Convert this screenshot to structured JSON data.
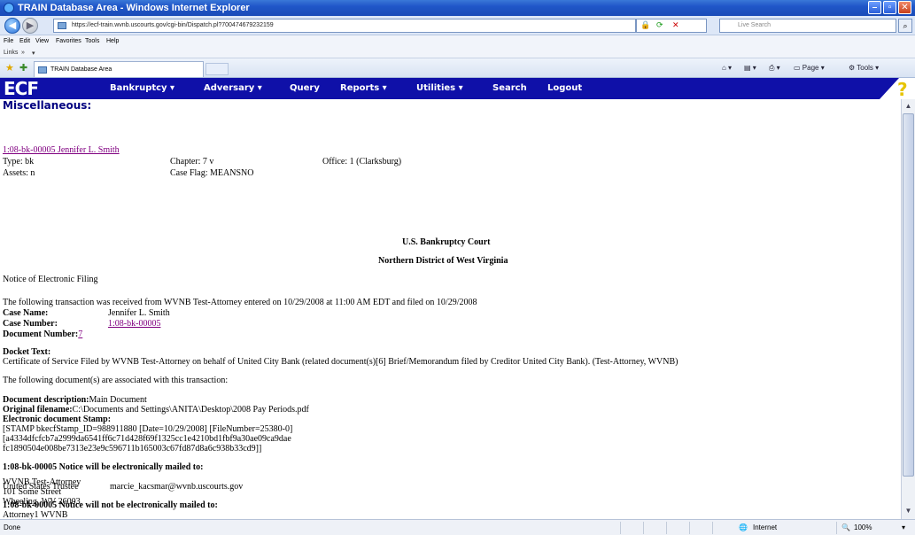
{
  "window": {
    "title": "TRAIN Database Area - Windows Internet Explorer",
    "colors": {
      "titlebar": "#1a4cb8",
      "ecf_nav": "#0f10a8",
      "link_visited": "#800080",
      "heading": "#000080"
    }
  },
  "browser": {
    "url": "https://ecf-train.wvnb.uscourts.gov/cgi-bin/Dispatch.pl?700474679232159",
    "search_placeholder": "Live Search",
    "menu": [
      "File",
      "Edit",
      "View",
      "Favorites",
      "Tools",
      "Help"
    ],
    "links_label": "Links",
    "tab_title": "TRAIN Database Area",
    "command_bar": [
      "Page",
      "Tools"
    ]
  },
  "ecf": {
    "logo": "ECF",
    "menu": [
      "Bankruptcy",
      "Adversary",
      "Query",
      "Reports",
      "Utilities",
      "Search",
      "Logout"
    ],
    "help_icon": "question-mark-icon"
  },
  "page": {
    "section_title": "Miscellaneous:",
    "case_link": "1:08-bk-00005 Jennifer L. Smith",
    "case_info": {
      "type": "Type: bk",
      "chapter": "Chapter: 7 v",
      "office": "Office: 1 (Clarksburg)",
      "assets": "Assets: n",
      "case_flag": "Case Flag: MEANSNO"
    },
    "court_name": "U.S. Bankruptcy Court",
    "district": "Northern District of West Virginia",
    "notice_title": "Notice of Electronic Filing",
    "transaction_text": "The following transaction was received from WVNB Test-Attorney entered on 10/29/2008 at 11:00 AM EDT and filed on 10/29/2008",
    "case_name_label": "Case Name:",
    "case_name": "Jennifer L. Smith",
    "case_number_label": "Case Number:",
    "case_number": "1:08-bk-00005",
    "document_number_label": "Document Number:",
    "document_number": "7",
    "docket_text_label": "Docket Text:",
    "docket_text": "Certificate of Service Filed by WVNB Test-Attorney on behalf of United City Bank (related document(s)[6] Brief/Memorandum filed by Creditor United City Bank). (Test-Attorney, WVNB)",
    "associated_docs": "The following document(s) are associated with this transaction:",
    "doc_description_label": "Document description:",
    "doc_description": "Main Document",
    "orig_filename_label": "Original filename:",
    "orig_filename": "C:\\Documents and Settings\\ANITA\\Desktop\\2008 Pay Periods.pdf",
    "stamp_label": "Electronic document Stamp:",
    "stamp_lines": [
      "[STAMP bkecfStamp_ID=988911880 [Date=10/29/2008] [FileNumber=25380-0]",
      "[a4334dfcfcb7a2999da6541ff6c71d428f69f1325cc1e4210bd1fbf9a30ae09ca9dae",
      "fc1890504e008be7313e23e9c596711b165003c67fd87d8a6c938b33cd9]]"
    ],
    "mailed_heading": "1:08-bk-00005 Notice will be electronically mailed to:",
    "mailed_recipient": "United States Trustee",
    "mailed_email": "marcie_kacsmar@wvnb.uscourts.gov",
    "not_mailed_heading": "1:08-bk-00005 Notice will not be electronically mailed to:",
    "not_mailed_address": [
      "WVNB Test-Attorney",
      "101 Some Street",
      "Wheeling, WV 26003"
    ],
    "attorney_cutoff": "Attorney1 WVNB"
  },
  "status": {
    "left": "Done",
    "zone": "Internet",
    "zoom": "100%"
  }
}
